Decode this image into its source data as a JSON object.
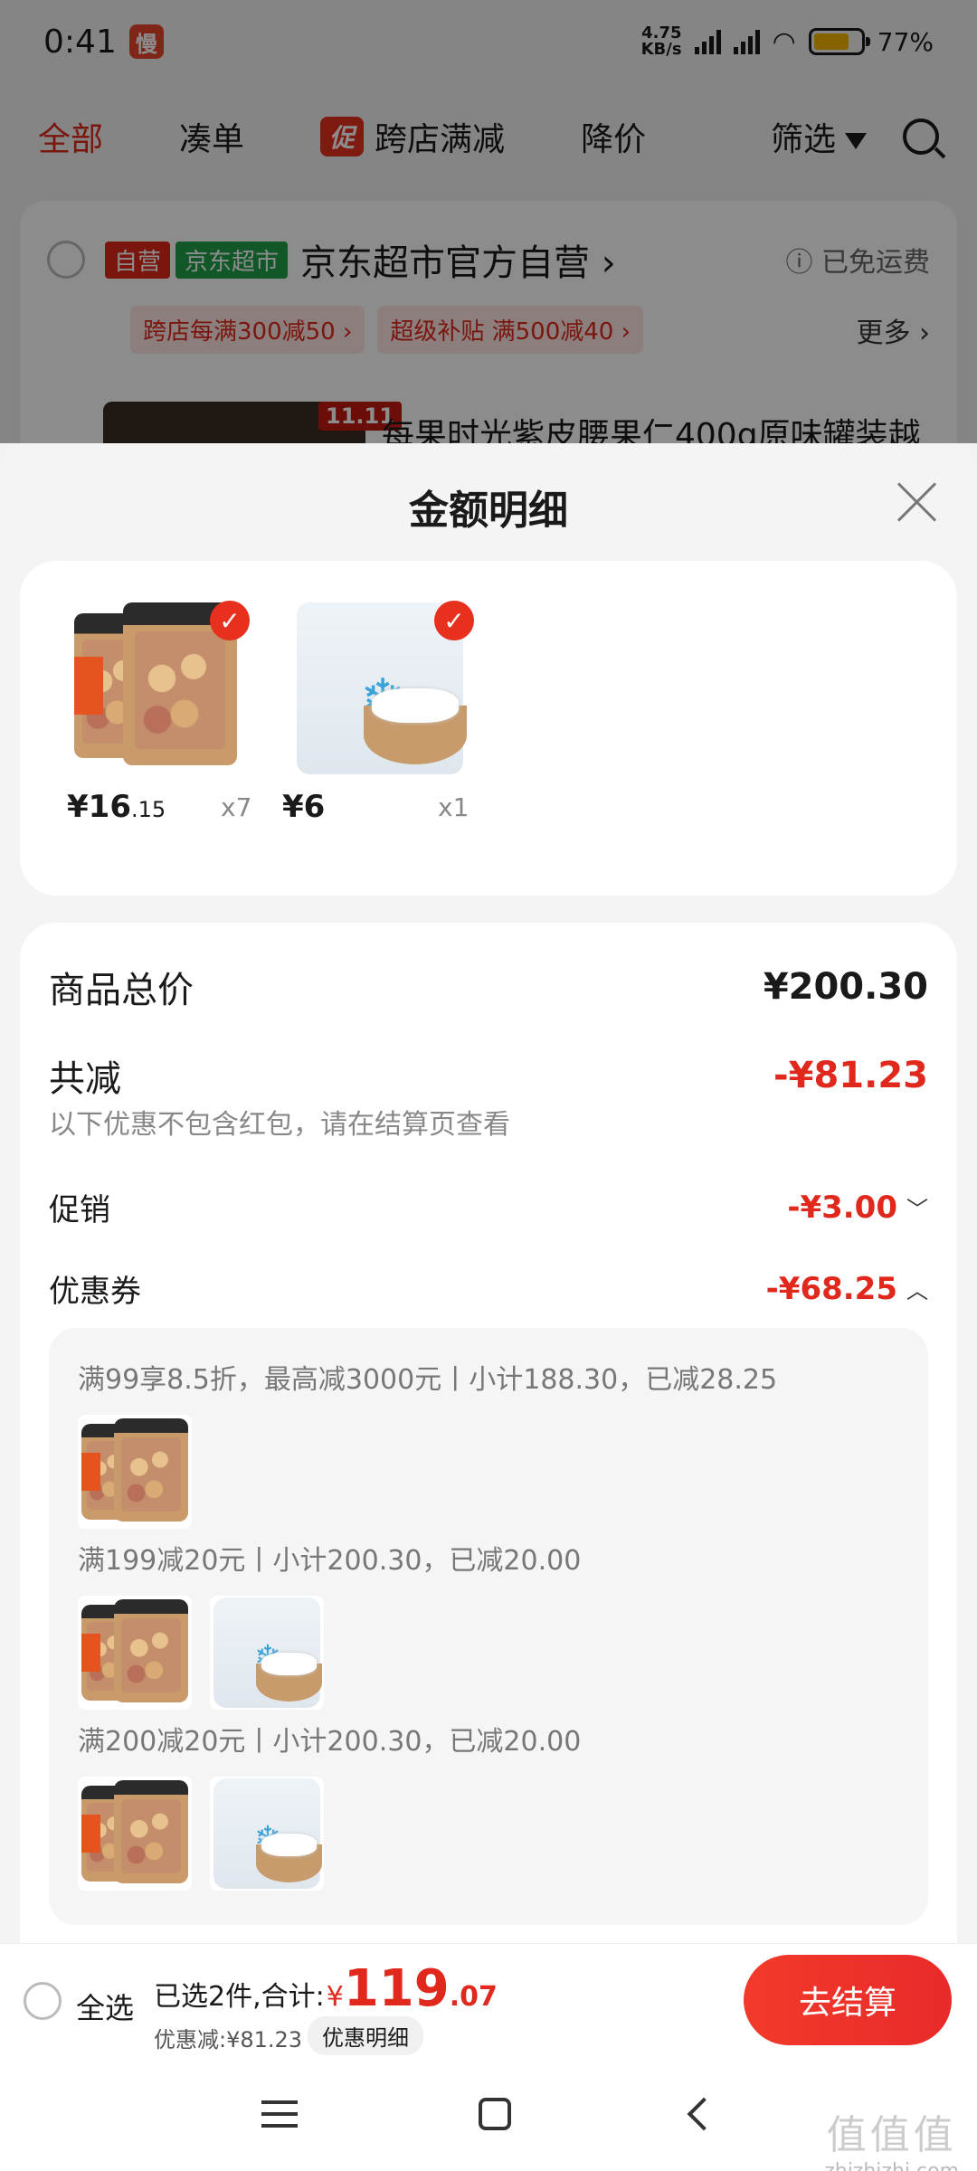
{
  "status_bar": {
    "time": "0:41",
    "app_icon_text": "慢",
    "net_speed_value": "4.75",
    "net_speed_unit": "KB/s",
    "battery": "77%"
  },
  "filter_bar": {
    "tabs": [
      "全部",
      "凑单"
    ],
    "promo_badge": "促",
    "promo_label": "跨店满减",
    "price_drop": "降价",
    "filter": "筛选"
  },
  "store": {
    "tag_self": "自营",
    "tag_mart": "京东超市",
    "name": "京东超市官方自营 ›",
    "free_shipping": "ⓘ 已免运费",
    "promos": [
      "跨店每满300减50 ›",
      "超级补贴 满500减40 ›"
    ],
    "more": "更多 ›",
    "item_badge": "11.11",
    "item_title": "每果时光紫皮腰果仁400g原味罐装越"
  },
  "sheet": {
    "title": "金额明细",
    "products": [
      {
        "price_int": "¥16",
        "price_dec": ".15",
        "qty": "x7",
        "check": "✓"
      },
      {
        "price_int": "¥6",
        "price_dec": "",
        "qty": "x1",
        "check": "✓"
      }
    ],
    "total_label": "商品总价",
    "total_value": "¥200.30",
    "reduce_label": "共减",
    "reduce_value": "-¥81.23",
    "note": "以下优惠不包含红包，请在结算页查看",
    "promo_label": "促销",
    "promo_value": "-¥3.00",
    "coupon_label": "优惠券",
    "coupon_value": "-¥68.25",
    "coupon_lines": [
      "满99享8.5折，最高减3000元丨小计188.30，已减28.25",
      "满199减20元丨小计200.30，已减20.00",
      "满200减20元丨小计200.30，已减20.00"
    ]
  },
  "bottom_bar": {
    "select_all": "全选",
    "selected_text": "已选2件,合计:",
    "yen": "¥",
    "total_int": "119",
    "total_dec": ".07",
    "discount": "优惠减:¥81.23",
    "detail_btn": "优惠明细",
    "checkout": "去结算"
  },
  "watermark": {
    "glyphs": "值值值",
    "site": "zhizhizhi.com"
  },
  "colors": {
    "accent": "#e0281c",
    "mart_green": "#1f9e4a",
    "sheet_bg": "#f4f4f4"
  }
}
